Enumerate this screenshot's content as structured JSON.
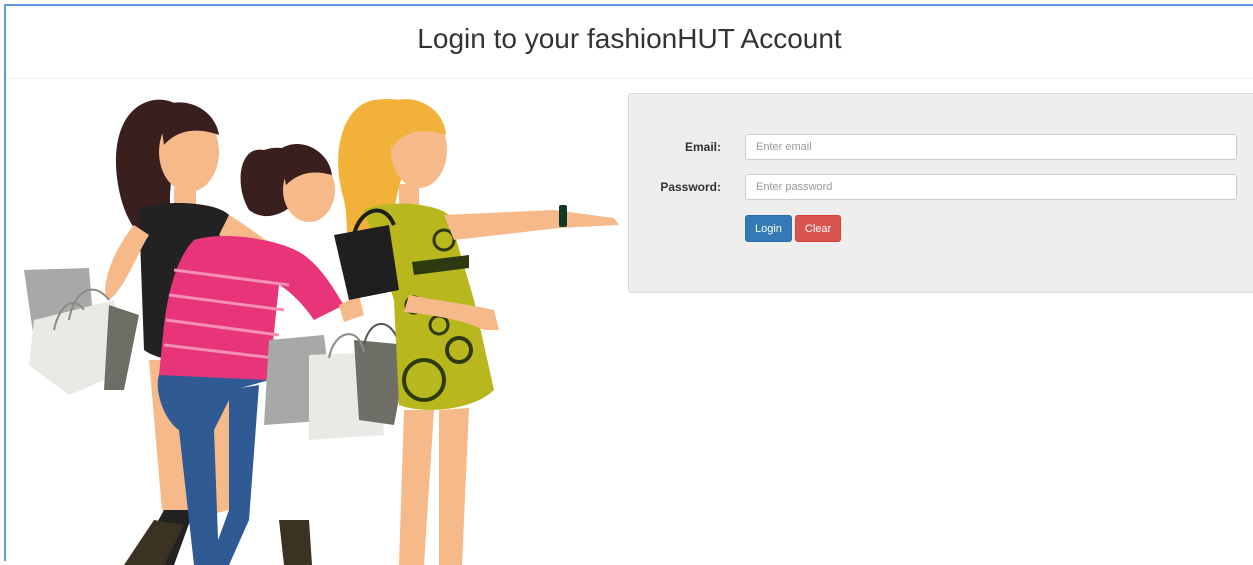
{
  "header": {
    "title": "Login to your fashionHUT Account"
  },
  "illustration": {
    "subject": "shopping-women-illustration",
    "colors": {
      "skin": "#f6b98a",
      "hair_dark": "#3a1f1f",
      "hair_blonde": "#f2b23a",
      "pink_top": "#e8357a",
      "yellow_dress": "#b8b81e",
      "jeans": "#2f5a94",
      "bag_gray": "#a7a9a6",
      "bag_white": "#e9e9e5",
      "bag_dark": "#6f6e66",
      "black": "#222222"
    }
  },
  "login_form": {
    "email_label": "Email:",
    "email_placeholder": "Enter email",
    "email_value": "",
    "password_label": "Password:",
    "password_placeholder": "Enter password",
    "password_value": "",
    "login_button": "Login",
    "clear_button": "Clear"
  },
  "colors": {
    "primary": "#337ab7",
    "danger": "#d9534f",
    "panel_bg": "#eeeeee",
    "frame_border": "#5b9bd5"
  }
}
